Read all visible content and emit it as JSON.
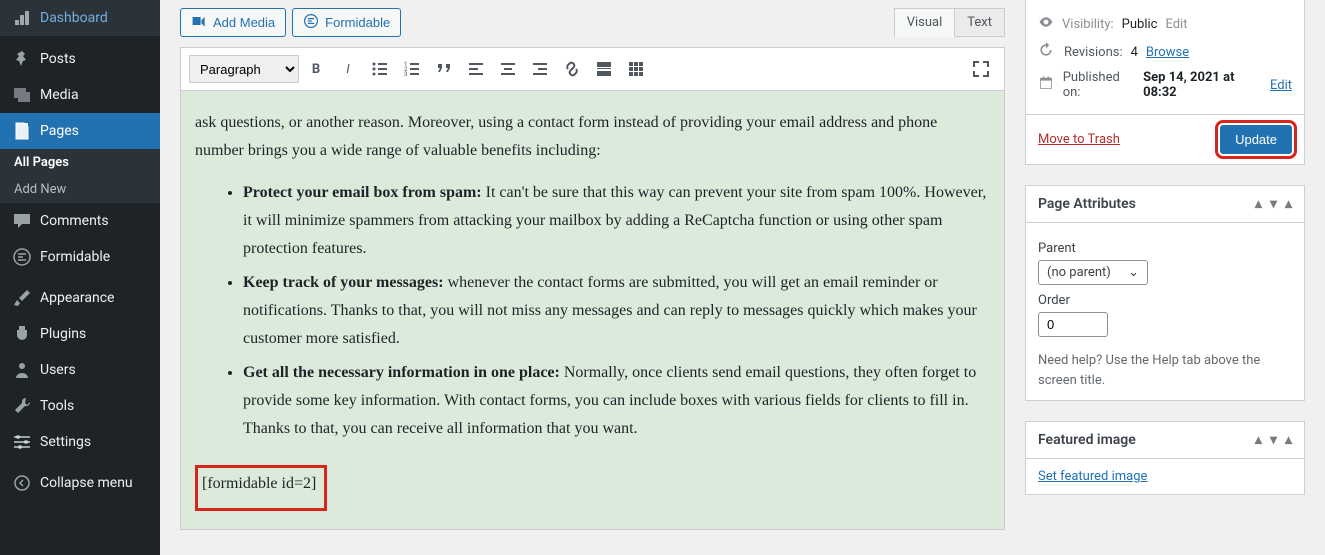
{
  "sidebar": {
    "items": [
      {
        "label": "Dashboard"
      },
      {
        "label": "Posts"
      },
      {
        "label": "Media"
      },
      {
        "label": "Pages"
      },
      {
        "label": "Comments"
      },
      {
        "label": "Formidable"
      },
      {
        "label": "Appearance"
      },
      {
        "label": "Plugins"
      },
      {
        "label": "Users"
      },
      {
        "label": "Tools"
      },
      {
        "label": "Settings"
      },
      {
        "label": "Collapse menu"
      }
    ],
    "subs": [
      {
        "label": "All Pages"
      },
      {
        "label": "Add New"
      }
    ]
  },
  "editor": {
    "add_media": "Add Media",
    "formidable": "Formidable",
    "tab_visual": "Visual",
    "tab_text": "Text",
    "format_dropdown": "Paragraph",
    "intro": "ask questions, or another reason. Moreover, using a contact form instead of providing your email address and phone number brings you a wide range of valuable benefits including:",
    "bullets": [
      {
        "bold": "Protect your email box from spam:",
        "rest": " It can't be sure that this way can prevent your site from spam 100%. However, it will minimize spammers from attacking your mailbox by adding a ReCaptcha function or using other spam protection features."
      },
      {
        "bold": "Keep track of your messages:",
        "rest": " whenever the contact forms are submitted, you will get an email reminder or notifications. Thanks to that, you will not miss any messages and can reply to messages quickly which makes your customer more satisfied."
      },
      {
        "bold": "Get all the necessary information in one place:",
        "rest": " Normally, once clients send email questions, they often forget to provide some key information. With contact forms, you can include boxes with various fields for clients to fill in. Thanks to that, you can receive all information that you want."
      }
    ],
    "shortcode": "[formidable id=2]"
  },
  "publish": {
    "visibility_label": "Visibility:",
    "visibility_value": "Public",
    "visibility_edit": "Edit",
    "revisions_label": "Revisions:",
    "revisions_count": "4",
    "revisions_browse": "Browse",
    "published_label": "Published on:",
    "published_value": "Sep 14, 2021 at 08:32",
    "published_edit": "Edit",
    "trash": "Move to Trash",
    "update": "Update"
  },
  "page_attr": {
    "title": "Page Attributes",
    "parent_label": "Parent",
    "parent_value": "(no parent)",
    "order_label": "Order",
    "order_value": "0",
    "help": "Need help? Use the Help tab above the screen title."
  },
  "featured": {
    "title": "Featured image",
    "link": "Set featured image"
  }
}
